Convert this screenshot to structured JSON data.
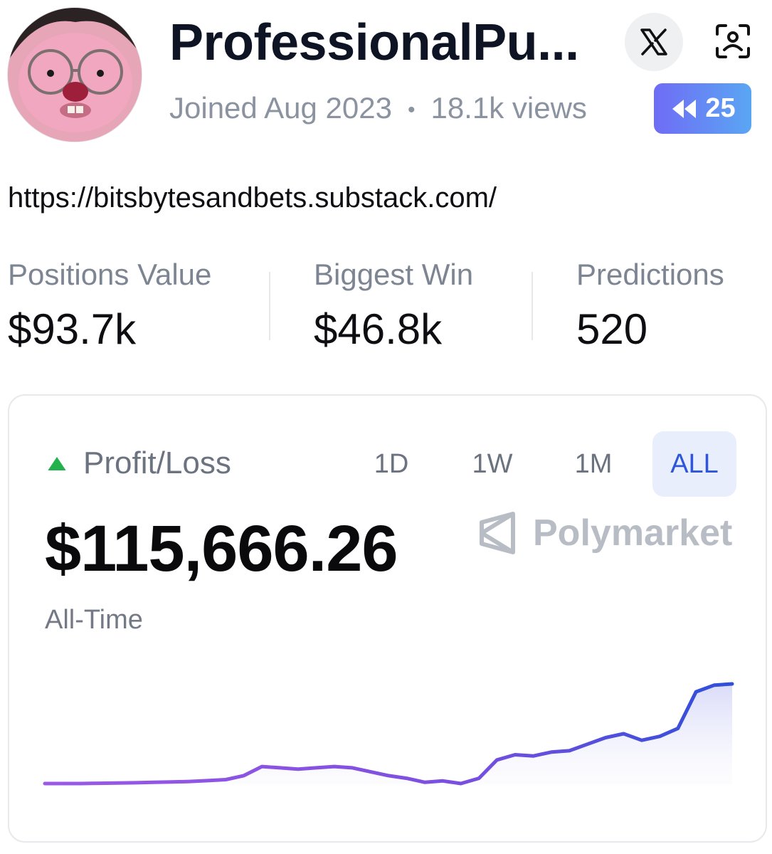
{
  "profile": {
    "username": "ProfessionalPu...",
    "joined": "Joined Aug 2023",
    "views": "18.1k views",
    "badge_count": "25",
    "url": "https://bitsbytesandbets.substack.com/"
  },
  "icons": {
    "x": "x-logo-icon",
    "scan": "face-scan-icon",
    "badge": "rewind-icon",
    "trend": "triangle-up-icon",
    "brand": "polymarket-logo-icon"
  },
  "stats": [
    {
      "label": "Positions Value",
      "value": "$93.7k"
    },
    {
      "label": "Biggest Win",
      "value": "$46.8k"
    },
    {
      "label": "Predictions",
      "value": "520"
    }
  ],
  "pnl": {
    "title": "Profit/Loss",
    "amount": "$115,666.26",
    "period": "All-Time",
    "brand": "Polymarket",
    "ranges": [
      "1D",
      "1W",
      "1M",
      "ALL"
    ],
    "active_range": "ALL"
  },
  "colors": {
    "trend_up": "#22b14c",
    "active_range_bg": "#e9eefc",
    "active_range_text": "#2f56d8",
    "line_start": "#9b59e6",
    "line_end": "#2f4fd8",
    "badge_start": "#6f6cf5",
    "badge_end": "#5aa6f3"
  },
  "chart_data": {
    "type": "area",
    "title": "",
    "xlabel": "",
    "ylabel": "",
    "grid": false,
    "values": [
      0,
      0,
      0,
      0.2,
      0.4,
      0.6,
      0.9,
      1.2,
      1.6,
      2.2,
      3,
      6,
      13,
      12,
      11,
      12,
      13,
      12,
      9,
      6,
      4,
      1,
      2,
      0,
      4,
      18,
      22,
      21,
      24,
      25,
      30,
      35,
      38,
      33,
      36,
      42,
      70,
      75,
      76
    ]
  }
}
